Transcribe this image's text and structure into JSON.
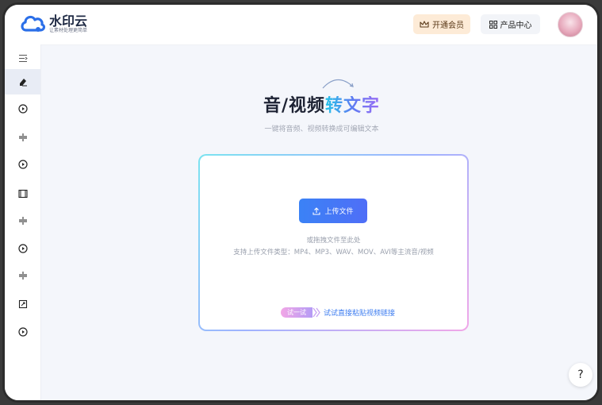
{
  "brand": {
    "name": "水印云",
    "tagline": "让素材处理更简单",
    "color": "#2b6fe8"
  },
  "header": {
    "vip_label": "开通会员",
    "products_label": "产品中心"
  },
  "sidebar": {
    "items": [
      {
        "icon": "menu-collapse-icon"
      },
      {
        "icon": "eraser-icon",
        "active": true
      },
      {
        "icon": "play-badge-icon"
      },
      {
        "icon": "divide-icon"
      },
      {
        "icon": "play-badge-icon"
      },
      {
        "icon": "film-icon"
      },
      {
        "icon": "divide-icon"
      },
      {
        "icon": "play-badge-icon"
      },
      {
        "icon": "divide-icon"
      },
      {
        "icon": "crop-icon"
      },
      {
        "icon": "play-badge-icon"
      }
    ]
  },
  "main": {
    "title_part1": "音/视频",
    "title_part2": "转文字",
    "subtitle": "一键将音频、视频转换成可编辑文本",
    "upload_label": "上传文件",
    "drop_hint": "或拖拽文件至此处",
    "support_text": "支持上传文件类型：MP4、MP3、WAV、MOV、AVI等主流音/视频",
    "try_badge": "试一试",
    "try_link": "试试直接粘贴视频链接"
  },
  "help": {
    "label": "?"
  }
}
